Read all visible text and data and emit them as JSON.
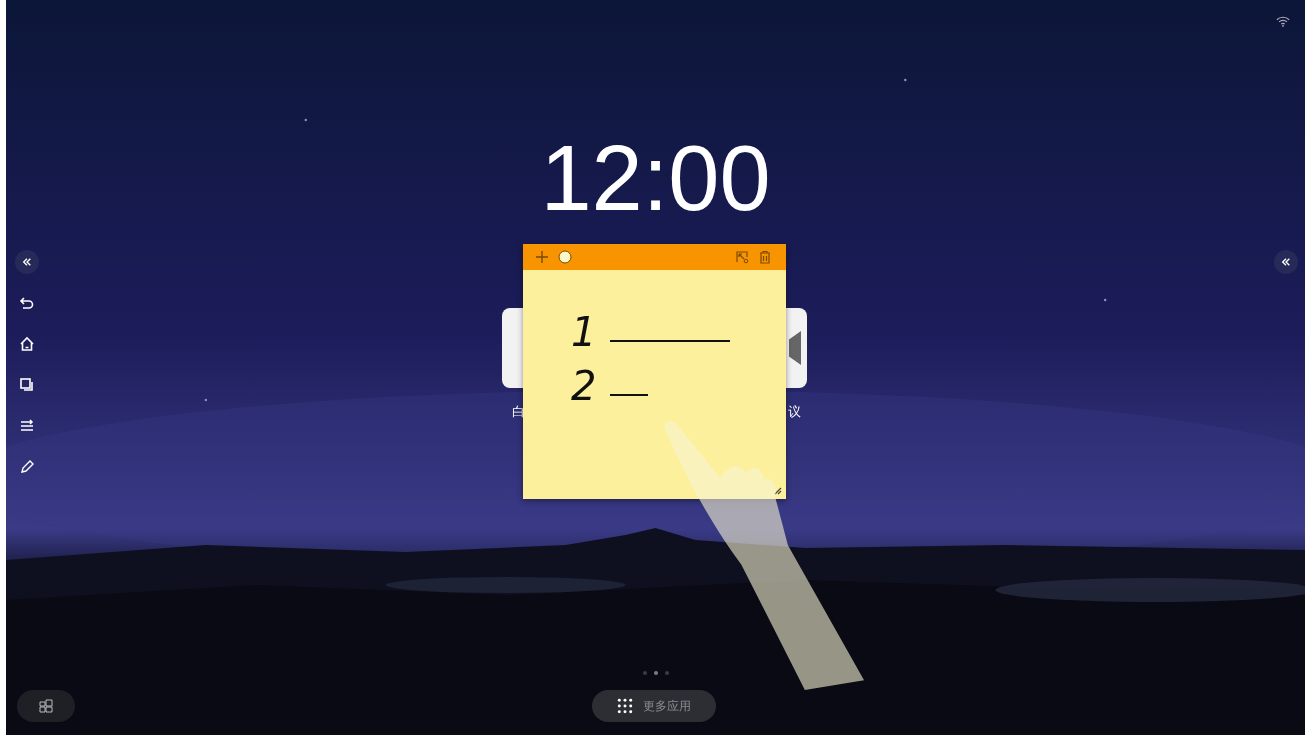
{
  "clock": {
    "time": "12:00"
  },
  "sticky_note": {
    "lines": [
      {
        "text": "1"
      },
      {
        "text": "2"
      }
    ]
  },
  "apps": [
    {
      "label": "白"
    },
    {
      "label": "议"
    }
  ],
  "pages": [
    {
      "selected": false
    },
    {
      "selected": true
    },
    {
      "selected": false
    }
  ],
  "more_apps_button": {
    "label": "更多应用"
  }
}
